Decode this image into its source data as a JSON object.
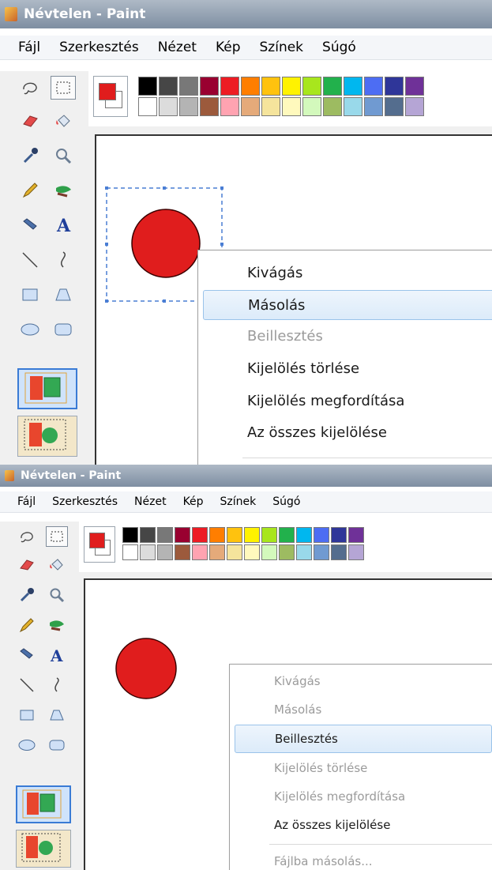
{
  "window": {
    "title": "Névtelen - Paint"
  },
  "menu": [
    "Fájl",
    "Szerkesztés",
    "Nézet",
    "Kép",
    "Színek",
    "Súgó"
  ],
  "palette": {
    "row1": [
      "#000000",
      "#464646",
      "#787878",
      "#990030",
      "#ed1c24",
      "#ff7e00",
      "#ffc20e",
      "#fff200",
      "#a8e61d",
      "#22b14c",
      "#00b7ef",
      "#4d6df3",
      "#2f3699",
      "#6f3198"
    ],
    "row2": [
      "#ffffff",
      "#dcdcdc",
      "#b4b4b4",
      "#9c5a3c",
      "#ffa3b1",
      "#e5aa7a",
      "#f5e49c",
      "#fff9bd",
      "#d3f9bc",
      "#9dbb61",
      "#99d9ea",
      "#709ad1",
      "#546d8e",
      "#b5a5d5"
    ],
    "foreground": "#e01d1d"
  },
  "tools": [
    "free-select-icon",
    "rect-select-icon",
    "eraser-icon",
    "fill-bucket-icon",
    "color-picker-icon",
    "magnifier-icon",
    "pencil-icon",
    "brush-icon",
    "airbrush-icon",
    "text-tool-icon",
    "line-icon",
    "curve-icon",
    "rectangle-icon",
    "polygon-icon",
    "ellipse-icon",
    "rounded-rect-icon"
  ],
  "shape_color": "#e01d1d",
  "context_menu_top": [
    {
      "label": "Kivágás",
      "enabled": true
    },
    {
      "label": "Másolás",
      "enabled": true,
      "highlighted": true
    },
    {
      "label": "Beillesztés",
      "enabled": false
    },
    {
      "label": "Kijelölés törlése",
      "enabled": true
    },
    {
      "label": "Kijelölés megfordítása",
      "enabled": true
    },
    {
      "label": "Az összes kijelölése",
      "enabled": true
    }
  ],
  "context_menu_bottom": [
    {
      "label": "Kivágás",
      "enabled": false
    },
    {
      "label": "Másolás",
      "enabled": false
    },
    {
      "label": "Beillesztés",
      "enabled": true,
      "highlighted": true
    },
    {
      "label": "Kijelölés törlése",
      "enabled": false
    },
    {
      "label": "Kijelölés megfordítása",
      "enabled": false
    },
    {
      "label": "Az összes kijelölése",
      "enabled": true
    },
    {
      "label": "Fájlba másolás...",
      "enabled": false
    }
  ]
}
